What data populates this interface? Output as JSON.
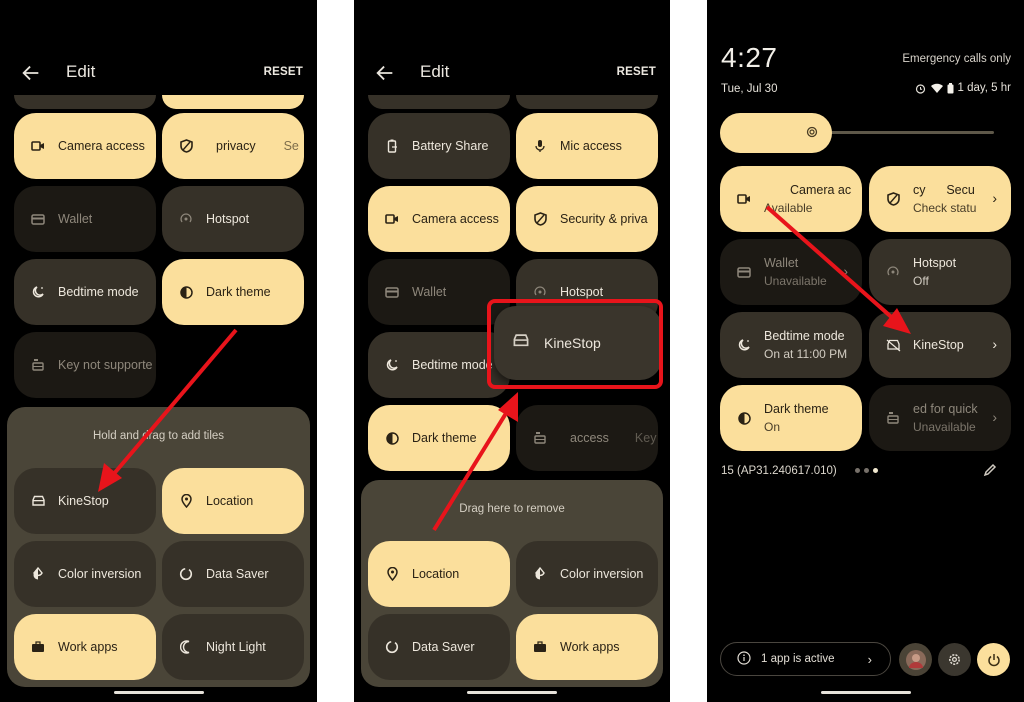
{
  "colors": {
    "tile_on": "#fbdf9c",
    "tile_off": "#363128",
    "tile_unavailable": "#1c1914",
    "tray": "#4a4538",
    "annotation_red": "#e8141b",
    "background": "#000000"
  },
  "panel1": {
    "header": {
      "title": "Edit",
      "reset_label": "RESET",
      "back_icon": "arrow-left-icon"
    },
    "active_tiles": [
      {
        "label": "Camera access",
        "icon": "video-camera-icon",
        "state": "on"
      },
      {
        "label": "privacy",
        "label_overflow": "Se",
        "icon": "shield-icon",
        "state": "on"
      },
      {
        "label": "Wallet",
        "icon": "card-icon",
        "state": "unavailable"
      },
      {
        "label": "Hotspot",
        "icon": "hotspot-icon",
        "state": "off"
      },
      {
        "label": "Bedtime mode",
        "icon": "moon-stars-icon",
        "state": "off"
      },
      {
        "label": "Dark theme",
        "icon": "half-circle-icon",
        "state": "on"
      },
      {
        "label": "Key not supporte",
        "icon": "car-key-icon",
        "state": "unavailable"
      }
    ],
    "tray": {
      "hint": "Hold and drag to add tiles",
      "tiles": [
        {
          "label": "KineStop",
          "icon": "car-icon",
          "state": "off"
        },
        {
          "label": "Location",
          "icon": "location-pin-icon",
          "state": "on"
        },
        {
          "label": "Color inversion",
          "icon": "drop-half-icon",
          "state": "off"
        },
        {
          "label": "Data Saver",
          "icon": "data-saver-icon",
          "state": "off"
        },
        {
          "label": "Work apps",
          "icon": "briefcase-icon",
          "state": "on"
        },
        {
          "label": "Night Light",
          "icon": "crescent-icon",
          "state": "off"
        }
      ]
    }
  },
  "panel2": {
    "header": {
      "title": "Edit",
      "reset_label": "RESET",
      "back_icon": "arrow-left-icon"
    },
    "active_tiles": [
      {
        "label": "Battery Share",
        "icon": "battery-share-icon",
        "state": "off"
      },
      {
        "label": "Mic access",
        "icon": "microphone-icon",
        "state": "on"
      },
      {
        "label": "Camera access",
        "icon": "video-camera-icon",
        "state": "on"
      },
      {
        "label": "Security & priva",
        "icon": "shield-icon",
        "state": "on"
      },
      {
        "label": "Wallet",
        "icon": "card-icon",
        "state": "unavailable"
      },
      {
        "label": "Hotspot",
        "icon": "hotspot-icon",
        "state": "off"
      },
      {
        "label": "Bedtime mode",
        "icon": "moon-stars-icon",
        "state": "off"
      },
      {
        "label": "Dark theme",
        "icon": "half-circle-icon",
        "state": "on"
      },
      {
        "label": "access",
        "label_overflow": "Key",
        "icon": "car-key-icon",
        "state": "unavailable"
      }
    ],
    "dragging_tile": {
      "label": "KineStop",
      "icon": "car-icon"
    },
    "tray": {
      "hint": "Drag here to remove",
      "tiles": [
        {
          "label": "Location",
          "icon": "location-pin-icon",
          "state": "on"
        },
        {
          "label": "Color inversion",
          "icon": "drop-half-icon",
          "state": "off"
        },
        {
          "label": "Data Saver",
          "icon": "data-saver-icon",
          "state": "off"
        },
        {
          "label": "Work apps",
          "icon": "briefcase-icon",
          "state": "on"
        }
      ]
    }
  },
  "panel3": {
    "status": {
      "time": "4:27",
      "date": "Tue, Jul 30",
      "carrier": "Emergency calls only",
      "battery_text": "1 day, 5 hr"
    },
    "brightness": {
      "level": 0.3
    },
    "tiles": [
      {
        "label": "Camera ac",
        "sub": "Available",
        "icon": "video-camera-icon",
        "state": "on",
        "chevron": false
      },
      {
        "label": "cy      Secu",
        "sub": "Check statu",
        "icon": "shield-icon",
        "state": "on",
        "chevron": true
      },
      {
        "label": "Wallet",
        "sub": "Unavailable",
        "icon": "card-icon",
        "state": "unavailable",
        "chevron": true
      },
      {
        "label": "Hotspot",
        "sub": "Off",
        "icon": "hotspot-icon",
        "state": "off",
        "chevron": false
      },
      {
        "label": "Bedtime mode",
        "sub": "On at 11:00 PM",
        "icon": "moon-stars-icon",
        "state": "off",
        "chevron": false
      },
      {
        "label": "KineStop",
        "sub": "",
        "icon": "car-off-icon",
        "state": "off",
        "chevron": true
      },
      {
        "label": "Dark theme",
        "sub": "On",
        "icon": "half-circle-icon",
        "state": "on",
        "chevron": false
      },
      {
        "label": "ed for quick",
        "sub": "Unavailable",
        "icon": "car-key-icon",
        "state": "unavailable",
        "chevron": true
      }
    ],
    "build": "15 (AP31.240617.010)",
    "pager": {
      "pages": 3,
      "current": 3
    },
    "footer": {
      "active_apps_label": "1 app is active",
      "chevron": ">"
    }
  },
  "glyphs": {
    "chevron": "›"
  }
}
